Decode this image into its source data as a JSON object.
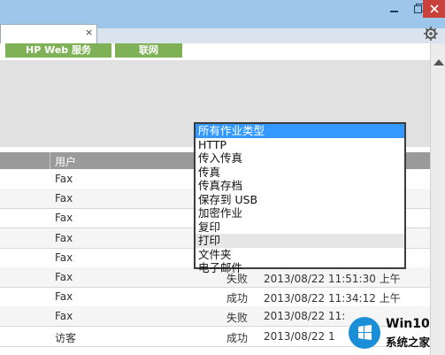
{
  "browser": {
    "tab_close_glyph": "×"
  },
  "nav": {
    "hpweb_label": "HP Web 服务",
    "link_label": "联网"
  },
  "table": {
    "header_user": "用户",
    "rows": [
      {
        "user": "Fax",
        "status": "",
        "time": ""
      },
      {
        "user": "Fax",
        "status": "",
        "time": ""
      },
      {
        "user": "Fax",
        "status": "",
        "time": ""
      },
      {
        "user": "Fax",
        "status": "",
        "time": ""
      },
      {
        "user": "Fax",
        "status": "",
        "time": ""
      },
      {
        "user": "Fax",
        "status": "失败",
        "time": "2013/08/22 11:51:30 上午"
      },
      {
        "user": "Fax",
        "status": "成功",
        "time": "2013/08/22 11:34:12 上午"
      },
      {
        "user": "Fax",
        "status": "失败",
        "time": "2013/08/22 11:"
      },
      {
        "user": "访客",
        "status": "成功",
        "time": "2013/08/22 1"
      }
    ]
  },
  "dropdown": {
    "options": [
      "所有作业类型",
      "HTTP",
      "传入传真",
      "传真",
      "传真存档",
      "保存到 USB",
      "加密作业",
      "复印",
      "打印",
      "文件夹",
      "电子邮件"
    ],
    "selected_index": 0,
    "hover_index": 8
  },
  "watermark": {
    "line1": "Win10",
    "line2": "系统之家"
  },
  "colors": {
    "accent": "#3399ff",
    "nav_green": "#7fb257",
    "title_bar": "#9ec6ea",
    "close_red": "#c8413a"
  }
}
